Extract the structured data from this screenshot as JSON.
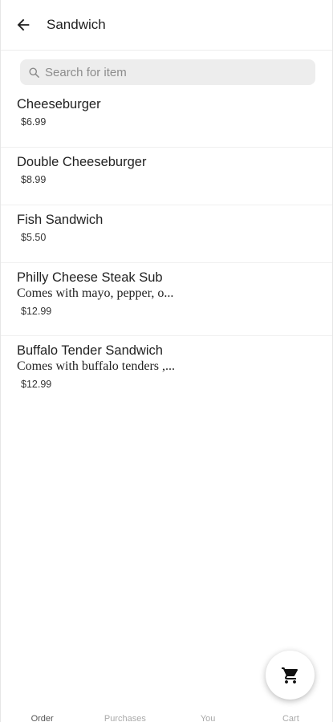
{
  "header": {
    "title": "Sandwich",
    "back_icon": "arrow-left-icon"
  },
  "search": {
    "placeholder": "Search for item",
    "value": ""
  },
  "items": [
    {
      "name": "Cheeseburger",
      "desc": "",
      "price": "$6.99"
    },
    {
      "name": "Double Cheeseburger",
      "desc": "",
      "price": "$8.99"
    },
    {
      "name": "Fish Sandwich",
      "desc": "",
      "price": "$5.50"
    },
    {
      "name": "Philly Cheese Steak Sub",
      "desc": "Comes with mayo, pepper, o...",
      "price": "$12.99"
    },
    {
      "name": "Buffalo Tender Sandwich",
      "desc": "Comes with buffalo tenders ,...",
      "price": "$12.99"
    }
  ],
  "fab": {
    "icon": "cart-icon"
  },
  "bottom_nav": [
    "Order",
    "Purchases",
    "You",
    "Cart"
  ]
}
